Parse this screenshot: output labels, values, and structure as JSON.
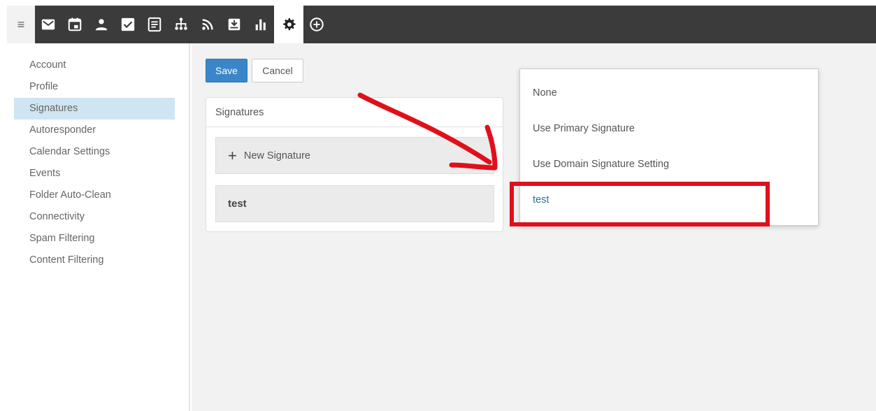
{
  "toolbar": {
    "hamburger_icon": "menu-icon",
    "icons": [
      "mail-icon",
      "calendar-icon",
      "contacts-icon",
      "tasks-icon",
      "notes-icon",
      "network-icon",
      "rss-icon",
      "inbox-download-icon",
      "bar-chart-icon",
      "gear-icon",
      "plus-circle-icon"
    ],
    "active": "gear-icon"
  },
  "sidebar": {
    "items": [
      {
        "label": "Account"
      },
      {
        "label": "Profile"
      },
      {
        "label": "Signatures",
        "selected": true
      },
      {
        "label": "Autoresponder"
      },
      {
        "label": "Calendar Settings"
      },
      {
        "label": "Events"
      },
      {
        "label": "Folder Auto-Clean"
      },
      {
        "label": "Connectivity"
      },
      {
        "label": "Spam Filtering"
      },
      {
        "label": "Content Filtering"
      }
    ]
  },
  "actions": {
    "save_label": "Save",
    "cancel_label": "Cancel"
  },
  "signatures_panel": {
    "title": "Signatures",
    "new_label": "New Signature",
    "items": [
      {
        "name": "test"
      }
    ]
  },
  "dropdown": {
    "options": [
      {
        "label": "None"
      },
      {
        "label": "Use Primary Signature"
      },
      {
        "label": "Use Domain Signature Setting"
      },
      {
        "label": "test",
        "highlighted": true
      }
    ]
  },
  "colors": {
    "toolbar_bg": "#3b3b3b",
    "accent": "#3a86c8",
    "selected_bg": "#cfe5f1",
    "annotation_red": "#e0101a"
  }
}
